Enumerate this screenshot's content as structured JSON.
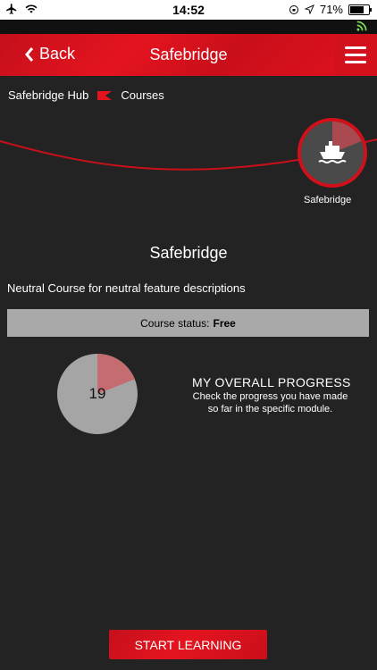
{
  "status_bar": {
    "time": "14:52",
    "battery": "71%"
  },
  "nav": {
    "back_label": "Back",
    "title": "Safebridge"
  },
  "breadcrumb": {
    "hub": "Safebridge Hub",
    "current": "Courses"
  },
  "module": {
    "label": "Safebridge",
    "progress": 0.19
  },
  "course": {
    "title": "Safebridge",
    "description": "Neutral Course for neutral feature descriptions",
    "status_label": "Course status:",
    "status_value": "Free"
  },
  "progress": {
    "value": 19,
    "value_label": "19",
    "title": "MY OVERALL PROGRESS",
    "description": "Check the progress you have made so far in the specific module."
  },
  "actions": {
    "start_label": "START LEARNING"
  },
  "colors": {
    "accent": "#d3111c",
    "background": "#232323",
    "pie_base": "#a5a5a5",
    "pie_fill": "#c46c70"
  },
  "icons": [
    "airplane-icon",
    "wifi-icon",
    "lock-rotation-icon",
    "location-arrow-icon",
    "battery-icon",
    "rss-icon",
    "chevron-left-icon",
    "hamburger-menu-icon",
    "flag-icon",
    "ship-icon"
  ]
}
